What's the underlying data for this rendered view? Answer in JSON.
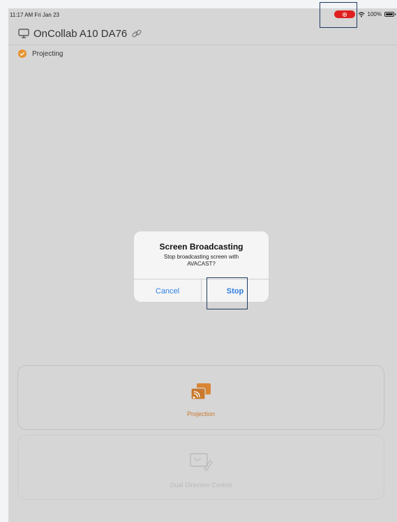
{
  "status_bar": {
    "time": "11:17 AM  Fri Jan 23",
    "battery": "100%"
  },
  "header": {
    "device_name": "OnCollab A10 DA76"
  },
  "status": {
    "projecting_label": "Projecting"
  },
  "dialog": {
    "title": "Screen Broadcasting",
    "message": "Stop broadcasting screen with AVACAST?",
    "cancel_label": "Cancel",
    "stop_label": "Stop"
  },
  "cards": {
    "projection_label": "Projection",
    "dual_label": "Dual Direction Control"
  },
  "colors": {
    "accent_orange": "#c97a2f",
    "ios_blue": "#2f7fe0",
    "record_red": "#e02020",
    "highlight": "#1f3a5f"
  }
}
